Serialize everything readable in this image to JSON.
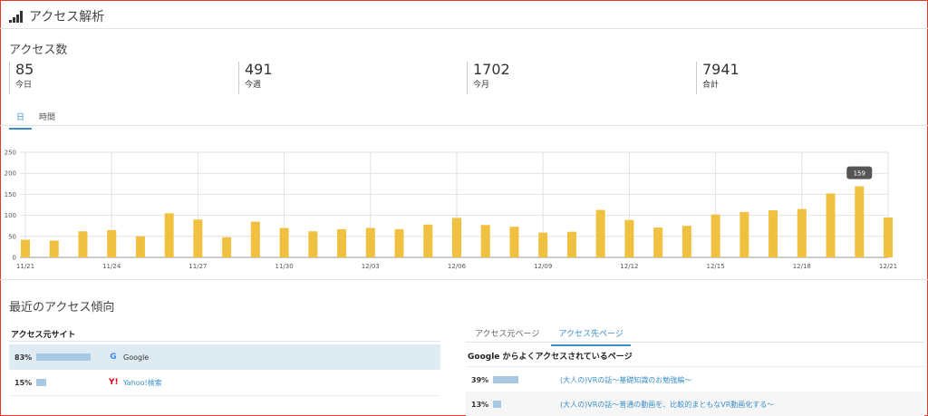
{
  "header": {
    "title": "アクセス解析",
    "icon": "signal-bars-icon"
  },
  "access_count": {
    "title": "アクセス数",
    "stats": [
      {
        "value": "85",
        "label": "今日"
      },
      {
        "value": "491",
        "label": "今週"
      },
      {
        "value": "1702",
        "label": "今月"
      },
      {
        "value": "7941",
        "label": "合計"
      }
    ],
    "tabs": [
      {
        "label": "日",
        "active": true
      },
      {
        "label": "時間",
        "active": false
      }
    ]
  },
  "chart_data": {
    "type": "bar",
    "x": [
      "11/21",
      "11/22",
      "11/23",
      "11/24",
      "11/25",
      "11/26",
      "11/27",
      "11/28",
      "11/29",
      "11/30",
      "12/01",
      "12/02",
      "12/03",
      "12/04",
      "12/05",
      "12/06",
      "12/07",
      "12/08",
      "12/09",
      "12/10",
      "12/11",
      "12/12",
      "12/13",
      "12/14",
      "12/15",
      "12/16",
      "12/17",
      "12/18",
      "12/19",
      "12/20",
      "12/21"
    ],
    "values": [
      42,
      40,
      62,
      65,
      50,
      105,
      90,
      48,
      85,
      70,
      62,
      67,
      70,
      67,
      78,
      94,
      77,
      73,
      59,
      61,
      113,
      89,
      71,
      75,
      102,
      108,
      112,
      115,
      152,
      169,
      95
    ],
    "tick_labels": [
      "11/21",
      "11/24",
      "11/27",
      "11/30",
      "12/03",
      "12/06",
      "12/09",
      "12/12",
      "12/15",
      "12/18",
      "12/21"
    ],
    "yticks": [
      0,
      50,
      100,
      150,
      200,
      250
    ],
    "ylim": [
      0,
      250
    ],
    "bar_color": "#f0c040",
    "tooltip": {
      "label": "159",
      "index": 29
    },
    "grid": true
  },
  "recent": {
    "title": "最近のアクセス傾向",
    "sources_title": "アクセス元サイト",
    "sources": [
      {
        "pct": "83%",
        "ratio": 0.83,
        "icon": "google-icon",
        "label": "Google",
        "link": false
      },
      {
        "pct": "15%",
        "ratio": 0.15,
        "icon": "yahoo-icon",
        "label": "Yahoo!検索",
        "link": true
      }
    ],
    "right_tabs": [
      {
        "label": "アクセス元ページ",
        "active": false
      },
      {
        "label": "アクセス先ページ",
        "active": true
      }
    ],
    "pages_title": "Google からよくアクセスされているページ",
    "pages": [
      {
        "pct": "39%",
        "ratio": 0.39,
        "label": "(大人の)VRの話～基礎知識のお勉強編～"
      },
      {
        "pct": "13%",
        "ratio": 0.13,
        "label": "(大人の)VRの話～普通の動画を、比較的まともなVR動画化する～"
      }
    ]
  },
  "colors": {
    "accent": "#3a8fc7",
    "highlight_row": "#deebf3",
    "bar_small": "#a8c8e4"
  }
}
